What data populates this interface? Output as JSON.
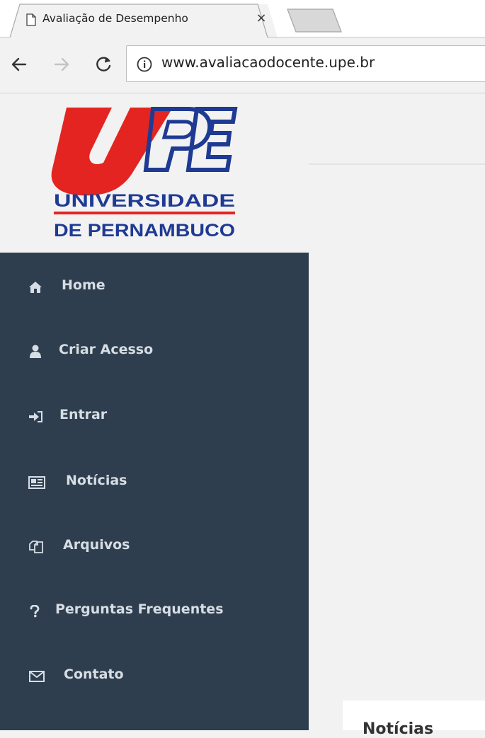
{
  "browser": {
    "tab_title": "Avaliação de Desempenho",
    "tab_close": "×",
    "url": "www.avaliacaodocente.upe.br"
  },
  "logo": {
    "line1": "UNIVERSIDADE",
    "line2": "DE PERNAMBUCO",
    "colors": {
      "red": "#e42421",
      "blue": "#1f3a93"
    }
  },
  "sidebar": {
    "items": [
      {
        "label": "Home",
        "icon": "home-icon"
      },
      {
        "label": "Criar Acesso",
        "icon": "user-icon"
      },
      {
        "label": "Entrar",
        "icon": "sign-in-icon"
      },
      {
        "label": "Notícias",
        "icon": "newspaper-icon"
      },
      {
        "label": "Arquivos",
        "icon": "files-icon"
      },
      {
        "label": "Perguntas Frequentes",
        "icon": "question-icon"
      },
      {
        "label": "Contato",
        "icon": "envelope-icon"
      }
    ]
  },
  "main": {
    "news_title": "Notícias"
  },
  "colors": {
    "sidebar_bg": "#2f3e4f",
    "sidebar_text": "#d6dde4",
    "page_bg": "#f2f2f2"
  }
}
